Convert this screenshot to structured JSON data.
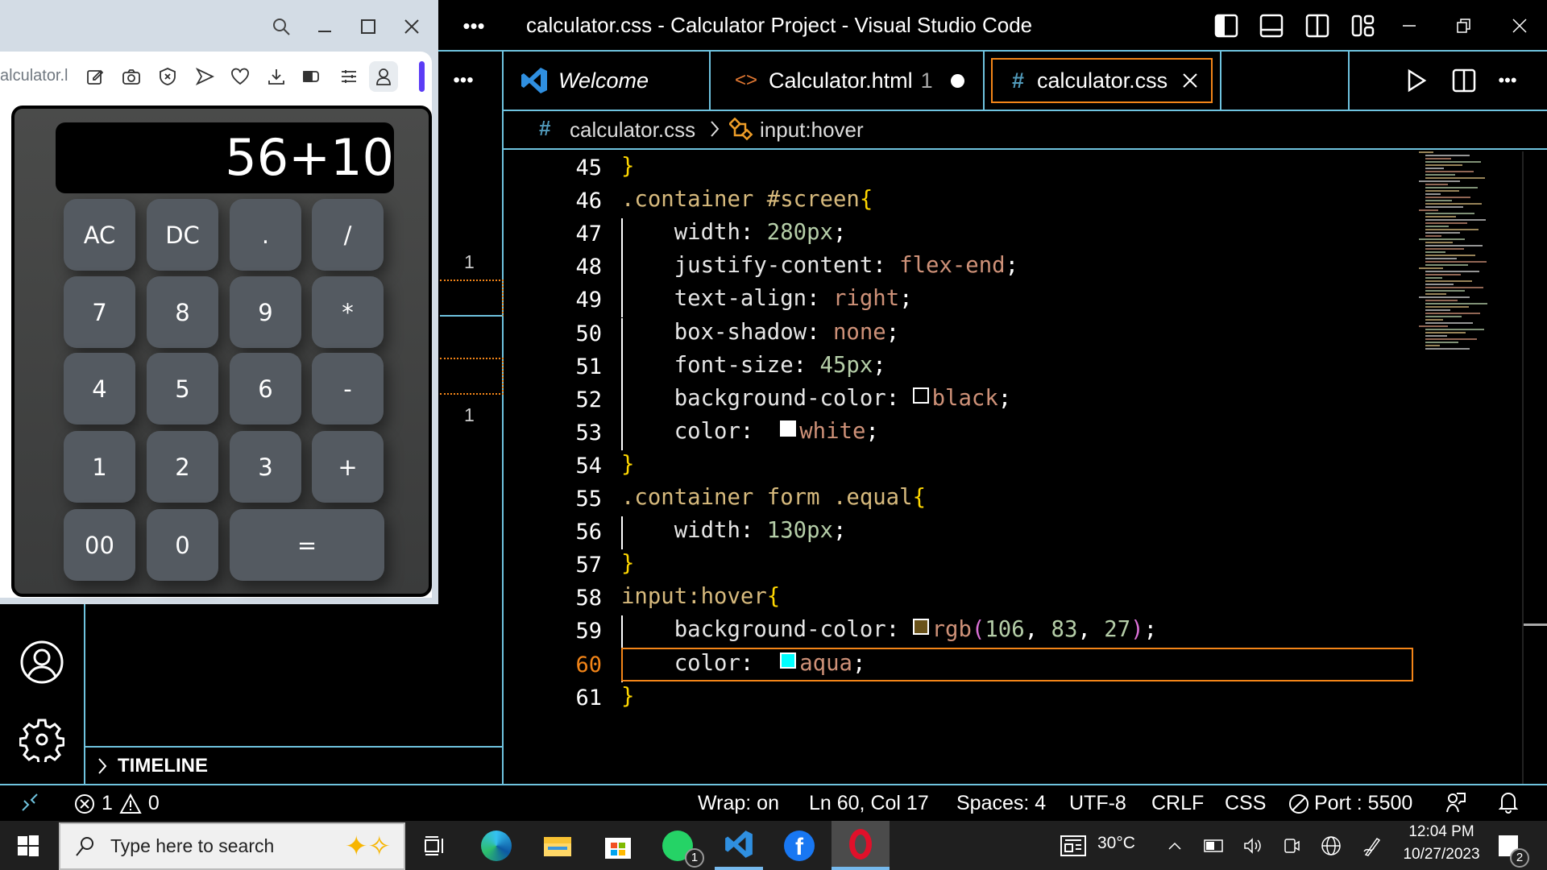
{
  "browser": {
    "url_fragment": "alculator.l",
    "toolbar_icons": [
      "edit-icon",
      "camera-icon",
      "shield-x-icon",
      "send-icon",
      "heart-icon",
      "download-icon",
      "battery-icon",
      "settings-sliders-icon",
      "profile-icon"
    ]
  },
  "calculator": {
    "display": "56+10",
    "keys": [
      [
        "AC",
        "DC",
        ".",
        "/"
      ],
      [
        "7",
        "8",
        "9",
        "*"
      ],
      [
        "4",
        "5",
        "6",
        "-"
      ],
      [
        "1",
        "2",
        "3",
        "+"
      ],
      [
        "00",
        "0",
        "="
      ]
    ]
  },
  "vscode": {
    "title": "calculator.css - Calculator Project - Visual Studio Code",
    "tabs": [
      {
        "label": "Welcome",
        "icon": "vscode-logo-icon"
      },
      {
        "label": "Calculator.html",
        "badge": "1",
        "dirty": true
      },
      {
        "label": "calculator.css",
        "active": true
      }
    ],
    "breadcrumb": {
      "file": "calculator.css",
      "symbol": "input:hover"
    },
    "sidebar": {
      "problem_counts": [
        "1",
        "1"
      ],
      "timeline_label": "TIMELINE"
    },
    "active_line": 60,
    "code": [
      {
        "n": "45",
        "indent": 0,
        "t": [
          [
            "brace",
            "}"
          ]
        ]
      },
      {
        "n": "46",
        "indent": 0,
        "t": [
          [
            "sel",
            ".container #screen"
          ],
          [
            "brace",
            "{"
          ]
        ]
      },
      {
        "n": "47",
        "indent": 1,
        "t": [
          [
            "prop",
            "width"
          ],
          [
            "p",
            ": "
          ],
          [
            "num",
            "280px"
          ],
          [
            "p",
            ";"
          ]
        ]
      },
      {
        "n": "48",
        "indent": 1,
        "t": [
          [
            "prop",
            "justify-content"
          ],
          [
            "p",
            ": "
          ],
          [
            "str",
            "flex-end"
          ],
          [
            "p",
            ";"
          ]
        ]
      },
      {
        "n": "49",
        "indent": 1,
        "t": [
          [
            "prop",
            "text-align"
          ],
          [
            "p",
            ": "
          ],
          [
            "str",
            "right"
          ],
          [
            "p",
            ";"
          ]
        ]
      },
      {
        "n": "50",
        "indent": 1,
        "t": [
          [
            "prop",
            "box-shadow"
          ],
          [
            "p",
            ": "
          ],
          [
            "str",
            "none"
          ],
          [
            "p",
            ";"
          ]
        ]
      },
      {
        "n": "51",
        "indent": 1,
        "t": [
          [
            "prop",
            "font-size"
          ],
          [
            "p",
            ": "
          ],
          [
            "num",
            "45px"
          ],
          [
            "p",
            ";"
          ]
        ]
      },
      {
        "n": "52",
        "indent": 1,
        "t": [
          [
            "prop",
            "background-color"
          ],
          [
            "p",
            ": "
          ],
          [
            "swatch",
            "#000000"
          ],
          [
            "str",
            "black"
          ],
          [
            "p",
            ";"
          ]
        ]
      },
      {
        "n": "53",
        "indent": 1,
        "t": [
          [
            "prop",
            "color"
          ],
          [
            "p",
            ":  "
          ],
          [
            "swatch",
            "#ffffff"
          ],
          [
            "str",
            "white"
          ],
          [
            "p",
            ";"
          ]
        ]
      },
      {
        "n": "54",
        "indent": 0,
        "t": [
          [
            "brace",
            "}"
          ]
        ]
      },
      {
        "n": "55",
        "indent": 0,
        "t": [
          [
            "sel",
            ".container form .equal"
          ],
          [
            "brace",
            "{"
          ]
        ]
      },
      {
        "n": "56",
        "indent": 1,
        "t": [
          [
            "prop",
            "width"
          ],
          [
            "p",
            ": "
          ],
          [
            "num",
            "130px"
          ],
          [
            "p",
            ";"
          ]
        ]
      },
      {
        "n": "57",
        "indent": 0,
        "t": [
          [
            "brace",
            "}"
          ]
        ]
      },
      {
        "n": "58",
        "indent": 0,
        "t": [
          [
            "sel",
            "input:hover"
          ],
          [
            "brace",
            "{"
          ]
        ]
      },
      {
        "n": "59",
        "indent": 1,
        "t": [
          [
            "prop",
            "background-color"
          ],
          [
            "p",
            ": "
          ],
          [
            "swatch",
            "#6a531b"
          ],
          [
            "str",
            "rgb"
          ],
          [
            "brace2",
            "("
          ],
          [
            "num",
            "106"
          ],
          [
            "p",
            ", "
          ],
          [
            "num",
            "83"
          ],
          [
            "p",
            ", "
          ],
          [
            "num",
            "27"
          ],
          [
            "brace2",
            ")"
          ],
          [
            "p",
            ";"
          ]
        ]
      },
      {
        "n": "60",
        "indent": 1,
        "t": [
          [
            "prop",
            "color"
          ],
          [
            "p",
            ":  "
          ],
          [
            "swatch",
            "#00ffff"
          ],
          [
            "str",
            "aqua"
          ],
          [
            "p",
            ";"
          ]
        ]
      },
      {
        "n": "61",
        "indent": 0,
        "t": [
          [
            "brace",
            "}"
          ]
        ]
      }
    ],
    "status": {
      "errors": "1",
      "warnings": "0",
      "wrap": "Wrap: on",
      "position": "Ln 60, Col 17",
      "spaces": "Spaces: 4",
      "encoding": "UTF-8",
      "eol": "CRLF",
      "language": "CSS",
      "port": "Port : 5500"
    },
    "colors": {
      "border": "#6fc3df",
      "active_border": "#f38518"
    }
  },
  "taskbar": {
    "search_placeholder": "Type here to search",
    "whatsapp_badge": "1",
    "weather": "30°C",
    "time": "12:04 PM",
    "date": "10/27/2023",
    "notifications": "2"
  }
}
